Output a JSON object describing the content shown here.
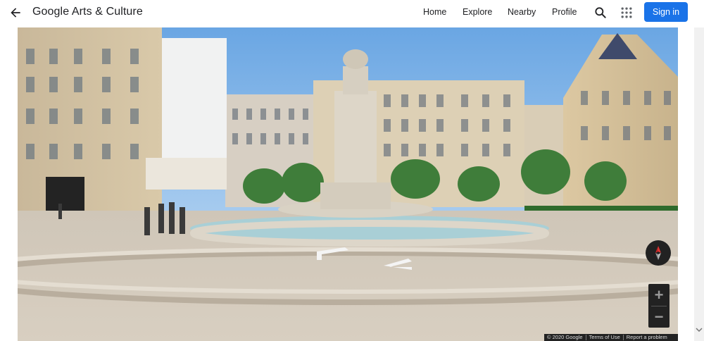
{
  "header": {
    "logo": "Google Arts & Culture",
    "nav": [
      "Home",
      "Explore",
      "Nearby",
      "Profile"
    ],
    "signin": "Sign in"
  },
  "icons": {
    "back": "arrow-back-icon",
    "search": "search-icon",
    "apps": "apps-grid-icon",
    "compass": "compass-icon",
    "zoom_in": "+",
    "zoom_out": "−"
  },
  "footer": {
    "copyright": "© 2020 Google",
    "terms": "Terms of Use",
    "report": "Report a problem"
  },
  "colors": {
    "accent": "#1a73e8",
    "sky": "#7fb6ea",
    "control_bg": "#222222"
  }
}
